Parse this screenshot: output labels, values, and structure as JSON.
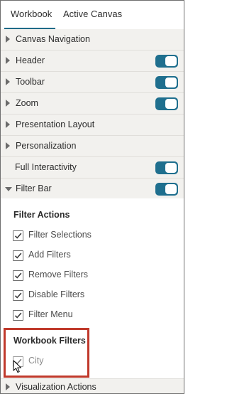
{
  "tabs": [
    {
      "label": "Workbook",
      "active": true
    },
    {
      "label": "Active Canvas",
      "active": false
    }
  ],
  "sections": [
    {
      "label": "Canvas Navigation",
      "expanded": false,
      "has_toggle": false
    },
    {
      "label": "Header",
      "expanded": false,
      "has_toggle": true,
      "toggle_on": true
    },
    {
      "label": "Toolbar",
      "expanded": false,
      "has_toggle": true,
      "toggle_on": true
    },
    {
      "label": "Zoom",
      "expanded": false,
      "has_toggle": true,
      "toggle_on": true
    },
    {
      "label": "Presentation Layout",
      "expanded": false,
      "has_toggle": false
    },
    {
      "label": "Personalization",
      "expanded": false,
      "has_toggle": false
    },
    {
      "label": "Full Interactivity",
      "expanded": null,
      "has_toggle": true,
      "toggle_on": true
    },
    {
      "label": "Filter Bar",
      "expanded": true,
      "has_toggle": true,
      "toggle_on": true
    }
  ],
  "filter_actions": {
    "heading": "Filter Actions",
    "items": [
      {
        "label": "Filter Selections",
        "checked": true
      },
      {
        "label": "Add Filters",
        "checked": true
      },
      {
        "label": "Remove Filters",
        "checked": true
      },
      {
        "label": "Disable Filters",
        "checked": true
      },
      {
        "label": "Filter Menu",
        "checked": true
      }
    ]
  },
  "workbook_filters": {
    "heading": "Workbook Filters",
    "items": [
      {
        "label": "City",
        "checked": true
      }
    ]
  },
  "footer_section": {
    "label": "Visualization Actions",
    "expanded": false
  },
  "colors": {
    "accent": "#1f6f8e",
    "highlight": "#c0392b",
    "row_background": "#f2f1ee"
  }
}
